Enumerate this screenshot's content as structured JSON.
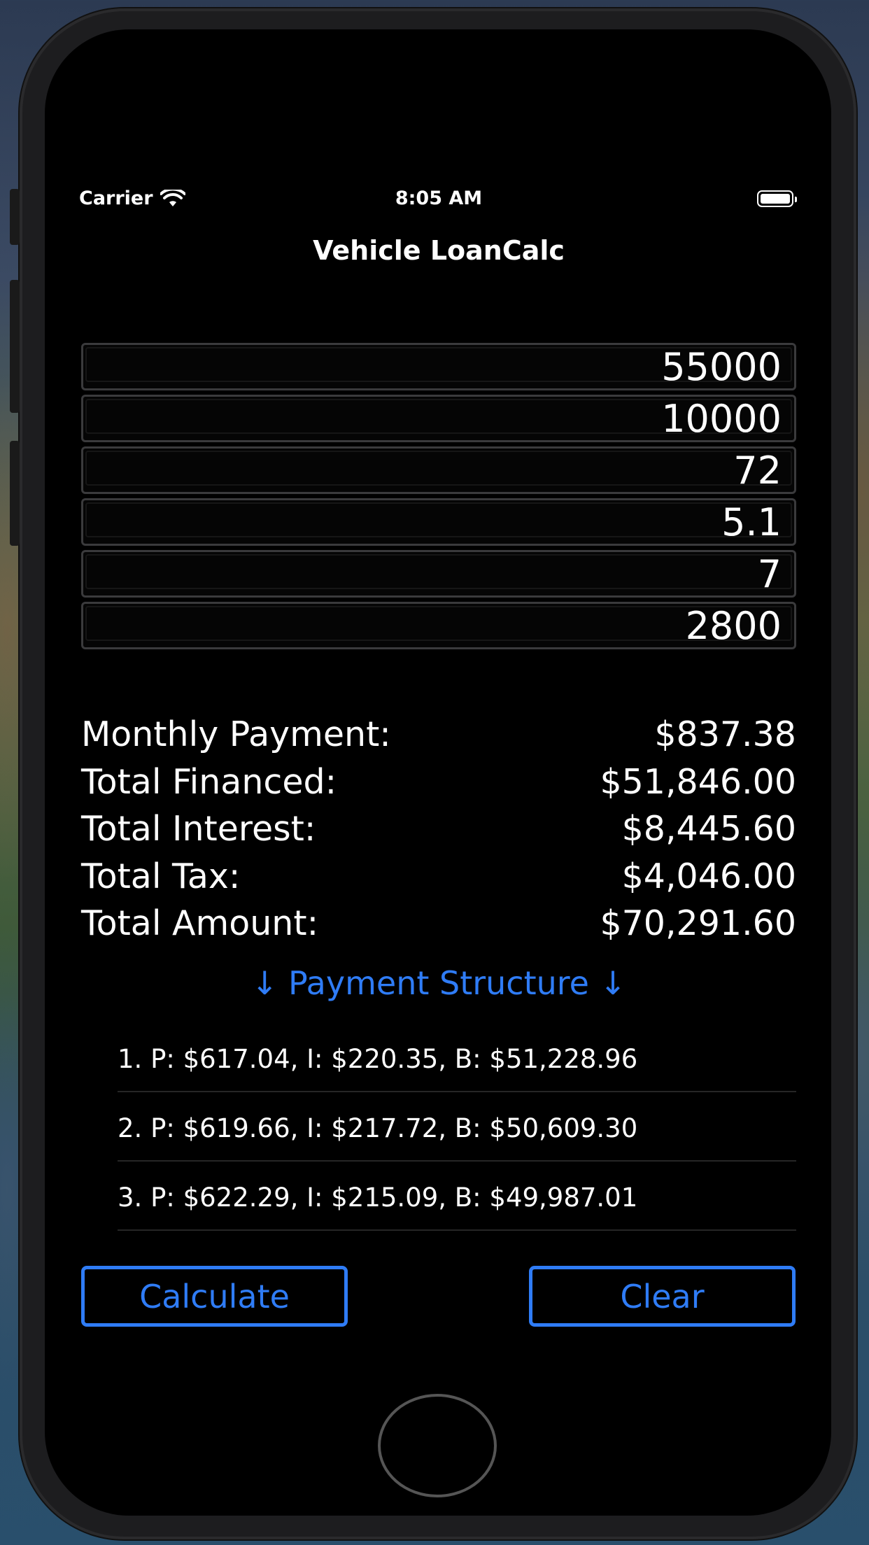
{
  "status_bar": {
    "carrier": "Carrier",
    "time": "8:05 AM"
  },
  "nav": {
    "title": "Vehicle LoanCalc"
  },
  "inputs": [
    "55000",
    "10000",
    "72",
    "5.1",
    "7",
    "2800"
  ],
  "results": [
    {
      "label": "Monthly Payment:",
      "value": "$837.38"
    },
    {
      "label": "Total Financed:",
      "value": "$51,846.00"
    },
    {
      "label": "Total Interest:",
      "value": "$8,445.60"
    },
    {
      "label": "Total Tax:",
      "value": "$4,046.00"
    },
    {
      "label": "Total Amount:",
      "value": "$70,291.60"
    }
  ],
  "payment_structure": {
    "header": "↓ Payment Structure ↓",
    "items": [
      "1. P: $617.04, I: $220.35, B: $51,228.96",
      "2. P: $619.66, I: $217.72, B: $50,609.30",
      "3. P: $622.29, I: $215.09, B: $49,987.01"
    ]
  },
  "buttons": {
    "calculate": "Calculate",
    "clear": "Clear"
  },
  "colors": {
    "accent": "#2f7cf6",
    "screen_bg": "#000000",
    "text": "#ffffff"
  }
}
